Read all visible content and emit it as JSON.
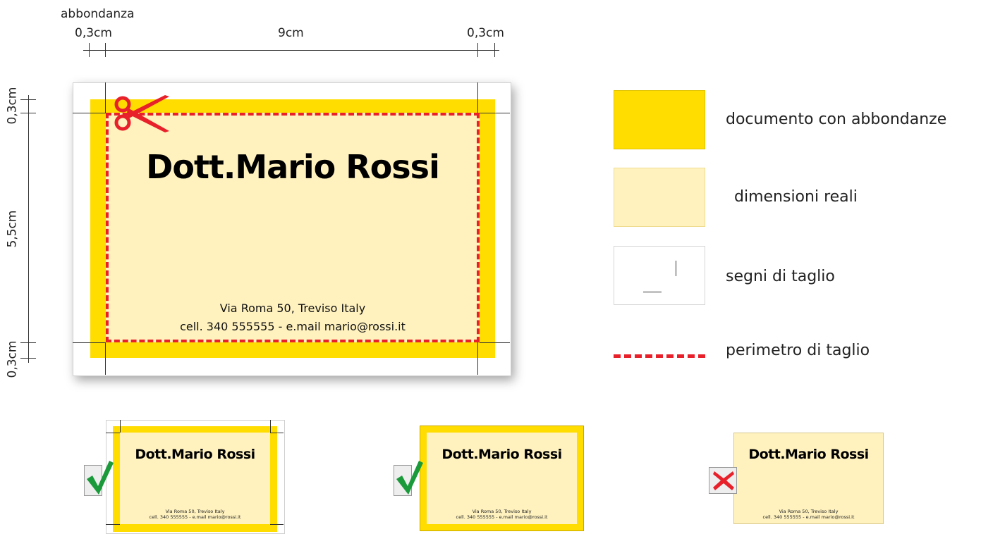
{
  "dimensions": {
    "bleed_caption": "abbondanza",
    "bleed_left": "0,3cm",
    "width": "9cm",
    "bleed_right": "0,3cm",
    "bleed_top": "0,3cm",
    "height": "5,5cm",
    "bleed_bottom": "0,3cm"
  },
  "card": {
    "name": "Dott.Mario Rossi",
    "address": "Via Roma 50, Treviso Italy",
    "contact": "cell. 340 555555 - e.mail mario@rossi.it"
  },
  "legend": [
    {
      "label": "documento con abbondanze",
      "color": "#ffdd00"
    },
    {
      "label": "dimensioni reali",
      "color": "#fff2bf"
    },
    {
      "label": "segni di taglio",
      "color": "#ffffff"
    },
    {
      "label": "perimetro di taglio",
      "color": "#e8202a"
    }
  ],
  "examples": [
    {
      "verdict": "check-icon",
      "color": "#1a9a3a"
    },
    {
      "verdict": "check-icon",
      "color": "#1a9a3a"
    },
    {
      "verdict": "cross-icon",
      "color": "#e8202a"
    }
  ]
}
